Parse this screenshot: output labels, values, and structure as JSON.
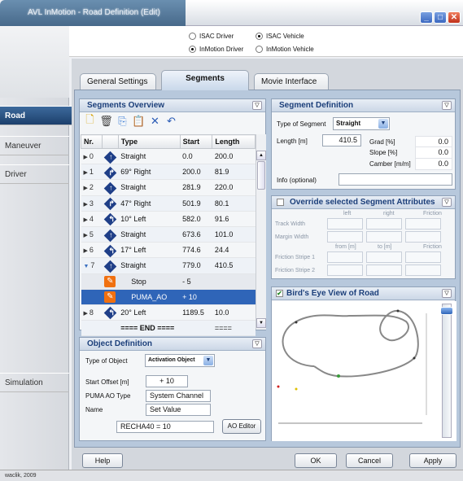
{
  "window": {
    "title": "AVL InMotion - Road Definition (Edit)"
  },
  "top_options": [
    {
      "label": "ISAC Driver",
      "selected": false
    },
    {
      "label": "ISAC Vehicle",
      "selected": true
    },
    {
      "label": "InMotion Driver",
      "selected": true
    },
    {
      "label": "InMotion Vehicle",
      "selected": false
    }
  ],
  "nav": {
    "items": [
      "Road",
      "Maneuver",
      "Driver",
      "Simulation"
    ],
    "active": "Road"
  },
  "tabs": [
    "General Settings",
    "Segments",
    "Movie Interface"
  ],
  "segments_overview": {
    "title": "Segments Overview",
    "columns": [
      "Nr.",
      "Type",
      "Start",
      "Length"
    ],
    "rows": [
      {
        "nr": "0",
        "type": "Straight",
        "start": "0.0",
        "length": "200.0",
        "icon": "straight-icon"
      },
      {
        "nr": "1",
        "type": "69° Right",
        "start": "200.0",
        "length": "81.9",
        "icon": "right-curve-icon"
      },
      {
        "nr": "2",
        "type": "Straight",
        "start": "281.9",
        "length": "220.0",
        "icon": "straight-icon"
      },
      {
        "nr": "3",
        "type": "47° Right",
        "start": "501.9",
        "length": "80.1",
        "icon": "right-curve-icon"
      },
      {
        "nr": "4",
        "type": "10° Left",
        "start": "582.0",
        "length": "91.6",
        "icon": "left-curve-icon"
      },
      {
        "nr": "5",
        "type": "Straight",
        "start": "673.6",
        "length": "101.0",
        "icon": "straight-icon"
      },
      {
        "nr": "6",
        "type": "17° Left",
        "start": "774.6",
        "length": "24.4",
        "icon": "left-curve-icon"
      },
      {
        "nr": "7",
        "type": "Straight",
        "start": "779.0",
        "length": "410.5",
        "icon": "straight-icon"
      },
      {
        "nr": "",
        "type": "Stop",
        "start": "- 5",
        "length": "",
        "icon": "object-icon"
      },
      {
        "nr": "",
        "type": "PUMA_AO",
        "start": "+ 10",
        "length": "",
        "icon": "object-icon"
      },
      {
        "nr": "8",
        "type": "20° Left",
        "start": "1189.5",
        "length": "10.0",
        "icon": "left-curve-icon"
      },
      {
        "nr": "",
        "type": "==== END ====",
        "start": "",
        "length": "====",
        "icon": ""
      }
    ]
  },
  "segment_definition": {
    "title": "Segment Definition",
    "type_label": "Type of Segment",
    "type_value": "Straight",
    "length_label": "Length [m]",
    "length_value": "410.5",
    "grad_label": "Grad [%]",
    "grad_value": "0.0",
    "slope_label": "Slope [%]",
    "slope_value": "0.0",
    "camber_label": "Camber [m/m]",
    "camber_value": "0.0",
    "info_label": "Info (optional)",
    "info_value": ""
  },
  "override": {
    "title": "Override selected Segment Attributes",
    "col_left": "left",
    "col_right": "right",
    "col_friction": "Friction",
    "row_track": "Track Width",
    "row_margin": "Margin Width",
    "col_from": "from [m]",
    "col_to": "to [m]",
    "row_fs1": "Friction Stripe 1",
    "row_fs2": "Friction Stripe 2"
  },
  "birds_eye": {
    "title": "Bird's Eye View of Road"
  },
  "object_definition": {
    "title": "Object Definition",
    "type_label": "Type of Object",
    "type_value": "Activation Object",
    "offset_label": "Start Offset [m]",
    "offset_value": "+ 10",
    "puma_label": "PUMA AO Type",
    "puma_value": "System Channel",
    "name_label": "Name",
    "name_value": "Set Value",
    "expr_value": "RECHA40 = 10",
    "ao_editor": "AO Editor"
  },
  "buttons": {
    "help": "Help",
    "ok": "OK",
    "cancel": "Cancel",
    "apply": "Apply"
  },
  "status": "waclik, 2009",
  "colors": {
    "accent": "#2f65b8",
    "nav_active": "#1c3f6c",
    "panel_bg": "#b7c8dc"
  }
}
